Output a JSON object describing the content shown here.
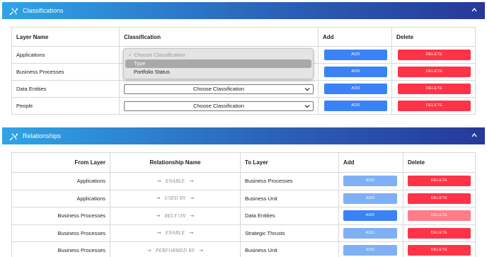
{
  "classifications": {
    "title": "Classifications",
    "headers": {
      "layer": "Layer Name",
      "classification": "Classification",
      "add": "Add",
      "delete": "Delete"
    },
    "rows": [
      {
        "layer": "Applications",
        "selected": "Choose Classification"
      },
      {
        "layer": "Business Processes",
        "selected": "Choose Classification"
      },
      {
        "layer": "Data Entities",
        "selected": "Choose Classification"
      },
      {
        "layer": "People",
        "selected": "Choose Classification"
      }
    ],
    "add_label": "ADD",
    "delete_label": "DELETE",
    "dropdown": {
      "placeholder": "Choose Classification",
      "options": [
        "Type",
        "Portfolio Status"
      ]
    }
  },
  "relationships": {
    "title": "Relationships",
    "headers": {
      "from": "From Layer",
      "name": "Relationship Name",
      "to": "To Layer",
      "add": "Add",
      "delete": "Delete"
    },
    "rows": [
      {
        "from": "Applications",
        "name": "ENABLE",
        "to": "Business Processes"
      },
      {
        "from": "Applications",
        "name": "USED BY",
        "to": "Business Unit"
      },
      {
        "from": "Business Processes",
        "name": "RELY ON",
        "to": "Data Entities"
      },
      {
        "from": "Business Processes",
        "name": "ENABLE",
        "to": "Strategic Thrusts"
      },
      {
        "from": "Business Processes",
        "name": "PERFORMED BY",
        "to": "Business Unit"
      }
    ],
    "add_label": "ADD",
    "delete_label": "DELETE"
  },
  "colors": {
    "add": "#3b82f6",
    "delete": "#ff3347",
    "header_start": "#2fa4e7",
    "header_end": "#27389a"
  }
}
